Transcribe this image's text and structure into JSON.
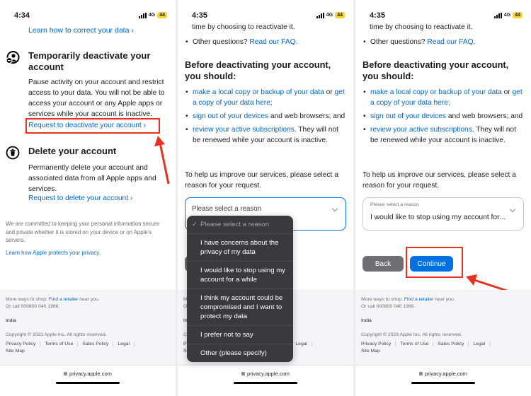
{
  "screens": [
    {
      "status": {
        "time": "4:34",
        "network": "4G",
        "battery": "44"
      },
      "top_link": "Learn how to correct your data ›",
      "deactivate": {
        "title": "Temporarily deactivate your account",
        "body": "Pause activity on your account and restrict access to your data. You will not be able to access your account or any Apple apps or services while your account is inactive.",
        "link": "Request to deactivate your account ›"
      },
      "delete": {
        "title": "Delete your account",
        "body": "Permanently delete your account and associated data from all Apple apps and services.",
        "link": "Request to delete your account ›"
      },
      "privacy_note": "We are committed to keeping your personal information secure and private whether it is stored on your device or on Apple’s servers.",
      "privacy_link": "Learn how Apple protects your privacy."
    },
    {
      "status": {
        "time": "4:35",
        "network": "4G",
        "battery": "44"
      },
      "dropdown_placeholder": "Please select a reason",
      "dropdown_options": [
        {
          "label": "Please select a reason",
          "selected": true,
          "check": "✓"
        },
        {
          "label": "I have concerns about the privacy of my data"
        },
        {
          "label": "I would like to stop using my account for a while"
        },
        {
          "label": "I think my account could be compromised and I want to protect my data"
        },
        {
          "label": "I prefer not to say"
        },
        {
          "label": "Other (please specify)"
        }
      ]
    },
    {
      "status": {
        "time": "4:35",
        "network": "4G",
        "battery": "44"
      },
      "select_label": "Please select a reason",
      "select_value": "I would like to stop using my account for...",
      "buttons": {
        "back": "Back",
        "continue": "Continue"
      }
    }
  ],
  "shared": {
    "cut_line": "time by choosing to reactivate it.",
    "faq_prefix": "Other questions? ",
    "faq_link": "Read our FAQ.",
    "heading": "Before deactivating your account, you should:",
    "bullets": {
      "b1_link1": "make a local copy or backup of your data",
      "b1_text": " or ",
      "b1_link2": "get a copy of your data here;",
      "b2_link": "sign out of your devices",
      "b2_text": " and web browsers; and",
      "b3_link": "review your active subscriptions",
      "b3_text": ". They will not be renewed while your account is inactive."
    },
    "prompt": "To help us improve our services, please select a reason for your request.",
    "footer": {
      "shop_prefix": "More ways to shop: ",
      "shop_link": "Find a retailer",
      "shop_suffix": " near you.",
      "call": "Or call 000800 040 1966.",
      "country": "India",
      "copyright": "Copyright © 2023 Apple Inc. All rights reserved.",
      "links": [
        "Privacy Policy",
        "Terms of Use",
        "Sales Policy",
        "Legal"
      ],
      "sitemap": "Site Map"
    },
    "url": "privacy.apple.com"
  },
  "colors": {
    "link": "#0066cc",
    "accent": "#0071e3",
    "annotation": "#e8321f",
    "battery": "#f6d43a"
  }
}
